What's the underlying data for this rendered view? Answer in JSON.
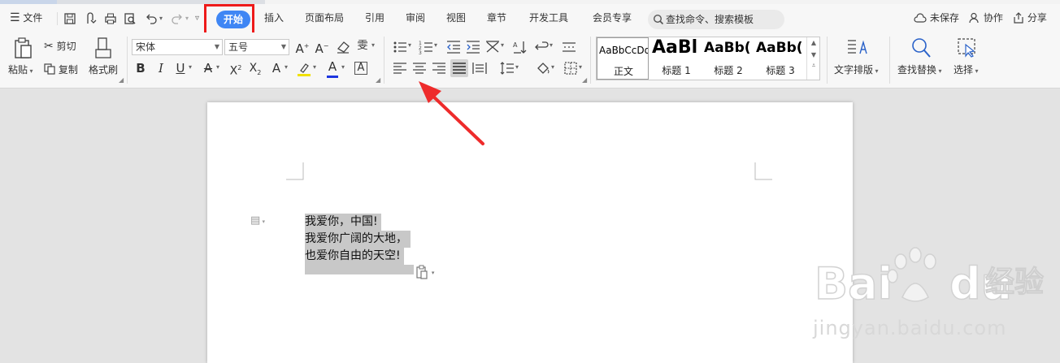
{
  "menubar": {
    "file_label": "文件",
    "tabs": [
      "开始",
      "插入",
      "页面布局",
      "引用",
      "审阅",
      "视图",
      "章节",
      "开发工具",
      "会员专享"
    ],
    "search_placeholder": "查找命令、搜索模板",
    "unsaved_label": "未保存",
    "collab_label": "协作",
    "share_label": "分享"
  },
  "ribbon": {
    "paste_label": "粘贴",
    "cut_label": "剪切",
    "copy_label": "复制",
    "format_painter_label": "格式刷",
    "font_name": "宋体",
    "font_size": "五号",
    "styles": [
      {
        "preview": "AaBbCcDd",
        "name": "正文"
      },
      {
        "preview": "AaBl",
        "name": "标题 1"
      },
      {
        "preview": "AaBb(",
        "name": "标题 2"
      },
      {
        "preview": "AaBb(",
        "name": "标题 3"
      }
    ],
    "text_layout_label": "文字排版",
    "find_replace_label": "查找替换",
    "select_label": "选择"
  },
  "document": {
    "lines": [
      "我爱你，中国!",
      "我爱你广阔的大地，",
      "也爱你自由的天空!"
    ]
  },
  "watermark": {
    "brand": "Bai du 经验",
    "url": "jingyan.baidu.com"
  },
  "colors": {
    "accent": "#3f86f4",
    "highlight_box": "#ee1a1a",
    "arrow": "#ee2b2b",
    "font_color_underline": "#1d36e0",
    "highlighter_underline": "#f0e000"
  }
}
